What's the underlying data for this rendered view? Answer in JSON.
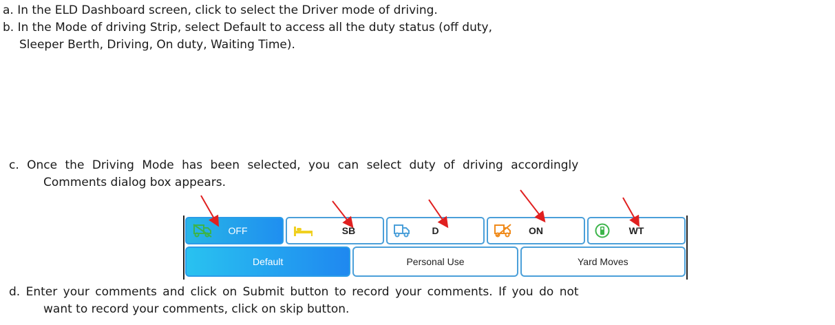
{
  "steps": {
    "a": "a. In the ELD Dashboard screen, click to select the Driver mode of driving.",
    "b_line1": "b. In the Mode of driving Strip, select Default to access all the duty status (off duty,",
    "b_line2": "Sleeper Berth, Driving, On duty, Waiting Time).",
    "c_line1": "c.   Once the Driving Mode has been selected, you can select duty of driving accordingly",
    "c_line2": "Comments dialog box appears.",
    "d_line1": "d.   Enter your comments and click on Submit button to record your comments.  If you do not",
    "d_line2": "want to record your comments, click on skip button."
  },
  "eld_strip": {
    "duty_buttons": [
      {
        "label": "OFF",
        "icon": "truck-off-icon",
        "active": true
      },
      {
        "label": "SB",
        "icon": "bed-icon",
        "active": false
      },
      {
        "label": "D",
        "icon": "truck-driving-icon",
        "active": false
      },
      {
        "label": "ON",
        "icon": "truck-on-duty-icon",
        "active": false
      },
      {
        "label": "WT",
        "icon": "fuel-wait-icon",
        "active": false
      }
    ],
    "mode_buttons": [
      {
        "label": "Default",
        "active": true
      },
      {
        "label": "Personal Use",
        "active": false
      },
      {
        "label": "Yard Moves",
        "active": false
      }
    ]
  },
  "colors": {
    "accent_blue": "#1f8ff0",
    "border_blue": "#4a9fd9",
    "arrow_red": "#e02020",
    "icon_green": "#3cb44a",
    "icon_orange": "#f08a1a",
    "icon_yellow": "#f0d020"
  }
}
